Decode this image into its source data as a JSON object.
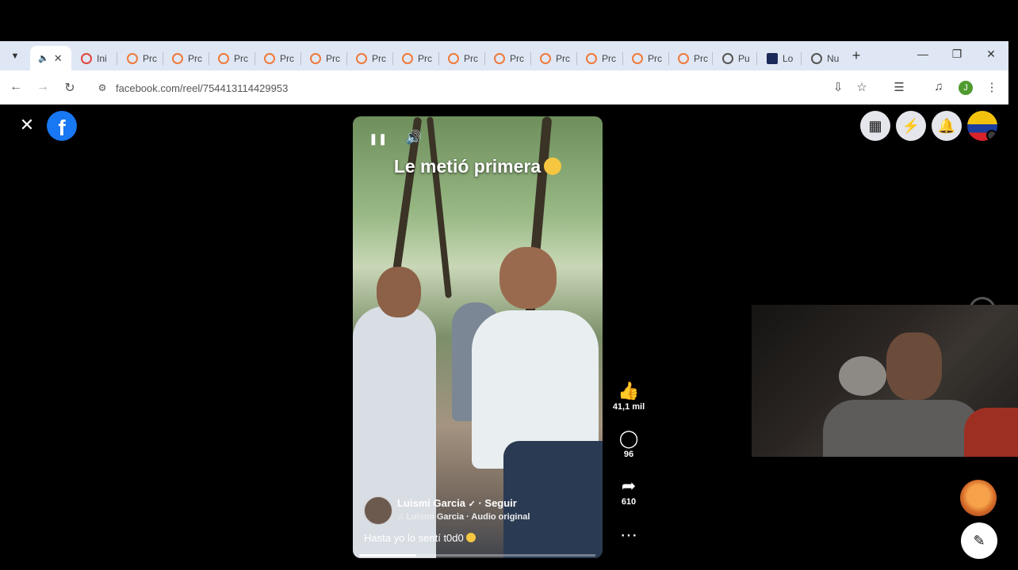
{
  "browser": {
    "tabs": [
      {
        "label": "",
        "active": true
      },
      {
        "label": "Ini"
      },
      {
        "label": "Prc"
      },
      {
        "label": "Prc"
      },
      {
        "label": "Prc"
      },
      {
        "label": "Prc"
      },
      {
        "label": "Prc"
      },
      {
        "label": "Prc"
      },
      {
        "label": "Prc"
      },
      {
        "label": "Prc"
      },
      {
        "label": "Prc"
      },
      {
        "label": "Prc"
      },
      {
        "label": "Prc"
      },
      {
        "label": "Prc"
      },
      {
        "label": "Prc"
      },
      {
        "label": "Pu"
      },
      {
        "label": "Lo"
      },
      {
        "label": "Nu"
      }
    ],
    "new_tab": "+",
    "url": "facebook.com/reel/754413114429953",
    "profile_initial": "J"
  },
  "reel": {
    "caption": "Le metió primera",
    "author_name": "Luismi Garcia",
    "follow_label": "· Seguir",
    "audio": "Luismi Garcia · Audio original",
    "description": "Hasta yo lo sentí t0d0",
    "progress": 0.24,
    "likes": "41,1 mil",
    "comments": "96",
    "shares": "610"
  },
  "icons": {
    "close": "close-icon",
    "facebook": "facebook-logo",
    "menu": "grid-icon",
    "messenger": "messenger-icon",
    "notifications": "bell-icon",
    "like": "thumbs-up-icon",
    "comment": "comment-icon",
    "share": "share-icon",
    "more": "more-icon",
    "compose": "compose-icon"
  }
}
